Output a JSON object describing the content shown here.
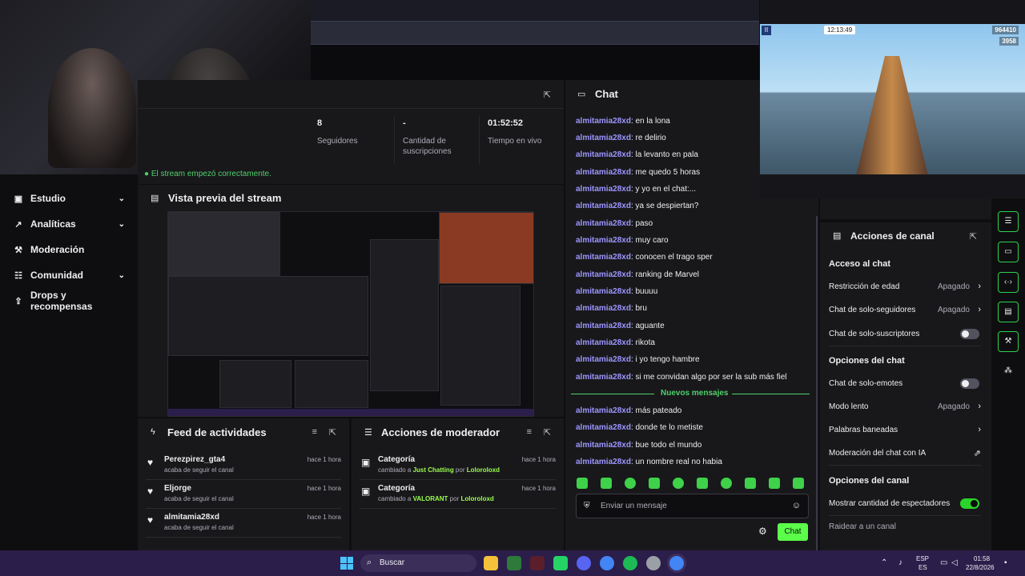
{
  "sidebar": {
    "items": [
      {
        "label": "Estudio",
        "icon": "studio-icon",
        "has_chevron": true
      },
      {
        "label": "Analíticas",
        "icon": "analytics-icon",
        "has_chevron": true
      },
      {
        "label": "Moderación",
        "icon": "wrench-icon",
        "has_chevron": false
      },
      {
        "label": "Comunidad",
        "icon": "community-icon",
        "has_chevron": true
      },
      {
        "label": "Drops y recompensas",
        "icon": "drops-icon",
        "has_chevron": false
      }
    ]
  },
  "stats": {
    "items": [
      {
        "value": "8",
        "caption": "Seguidores"
      },
      {
        "value": "-",
        "caption": "Cantidad de suscripciones"
      },
      {
        "value": "01:52:52",
        "caption": "Tiempo en vivo"
      }
    ],
    "success_message": "El stream empezó correctamente."
  },
  "preview": {
    "title": "Vista previa del stream"
  },
  "game": {
    "timer": "12:13:49",
    "score": "964410",
    "coins": "3958"
  },
  "feed": {
    "title": "Feed de actividades",
    "items": [
      {
        "name": "Perezpirez_gta4",
        "sub": "acaba de seguir el canal",
        "time": "hace 1 hora"
      },
      {
        "name": "Eljorge",
        "sub": "acaba de seguir el canal",
        "time": "hace 1 hora"
      },
      {
        "name": "almitamia28xd",
        "sub": "acaba de seguir el canal",
        "time": "hace 1 hora"
      }
    ]
  },
  "mod_actions": {
    "title": "Acciones de moderador",
    "items": [
      {
        "name": "Categoría",
        "prefix": "cambiado a ",
        "value": "Just Chatting",
        "by": " por ",
        "user": "Loloroloxd",
        "time": "hace 1 hora"
      },
      {
        "name": "Categoría",
        "prefix": "cambiado a ",
        "value": "VALORANT",
        "by": " por ",
        "user": "Loloroloxd",
        "time": "hace 1 hora"
      }
    ]
  },
  "chat": {
    "title": "Chat",
    "messages_before": [
      {
        "user": "almitamia28xd",
        "text": ": en la lona"
      },
      {
        "user": "almitamia28xd",
        "text": ": re delirio"
      },
      {
        "user": "almitamia28xd",
        "text": ": la levanto en pala"
      },
      {
        "user": "almitamia28xd",
        "text": ": me quedo 5 horas"
      },
      {
        "user": "almitamia28xd",
        "text": ": y yo en el chat:..."
      },
      {
        "user": "almitamia28xd",
        "text": ": ya se despiertan?"
      },
      {
        "user": "almitamia28xd",
        "text": ": paso"
      },
      {
        "user": "almitamia28xd",
        "text": ": muy caro"
      },
      {
        "user": "almitamia28xd",
        "text": ": conocen el trago sper"
      },
      {
        "user": "almitamia28xd",
        "text": ": ranking de Marvel"
      },
      {
        "user": "almitamia28xd",
        "text": ": buuuu"
      },
      {
        "user": "almitamia28xd",
        "text": ": bru"
      },
      {
        "user": "almitamia28xd",
        "text": ": aguante"
      },
      {
        "user": "almitamia28xd",
        "text": ": rikota"
      },
      {
        "user": "almitamia28xd",
        "text": ": i yo tengo hambre"
      },
      {
        "user": "almitamia28xd",
        "text": ": si me convidan algo por ser la sub más fiel"
      }
    ],
    "new_messages_label": "Nuevos mensajes",
    "messages_after": [
      {
        "user": "almitamia28xd",
        "text": ": más pateado"
      },
      {
        "user": "almitamia28xd",
        "text": ": donde te lo metiste"
      },
      {
        "user": "almitamia28xd",
        "text": ": bue todo el mundo"
      },
      {
        "user": "almitamia28xd",
        "text": ": un nombre real no habia"
      }
    ],
    "input_placeholder": "Enviar un mensaje",
    "send_label": "Chat"
  },
  "channel_actions": {
    "title": "Acciones de canal",
    "sections": [
      {
        "title": "Acceso al chat",
        "options": [
          {
            "label": "Restricción de edad",
            "value": "Apagado",
            "control": "chevron"
          },
          {
            "label": "Chat de solo-seguidores",
            "value": "Apagado",
            "control": "chevron"
          },
          {
            "label": "Chat de solo-suscriptores",
            "value": "",
            "control": "toggle",
            "on": false
          }
        ]
      },
      {
        "title": "Opciones del chat",
        "options": [
          {
            "label": "Chat de solo-emotes",
            "value": "",
            "control": "toggle",
            "on": false
          },
          {
            "label": "Modo lento",
            "value": "Apagado",
            "control": "chevron"
          },
          {
            "label": "Palabras baneadas",
            "value": "",
            "control": "chevron"
          },
          {
            "label": "Moderación del chat con IA",
            "value": "",
            "control": "external"
          }
        ]
      },
      {
        "title": "Opciones del canal",
        "options": [
          {
            "label": "Mostrar cantidad de espectadores",
            "value": "",
            "control": "toggle",
            "on": true
          },
          {
            "label": "Raidear a un canal",
            "value": "",
            "control": "none"
          }
        ]
      }
    ]
  },
  "taskbar": {
    "search_label": "Buscar",
    "lang_top": "ESP",
    "lang_bottom": "ES",
    "time": "01:58",
    "date": "22/8/2026"
  }
}
